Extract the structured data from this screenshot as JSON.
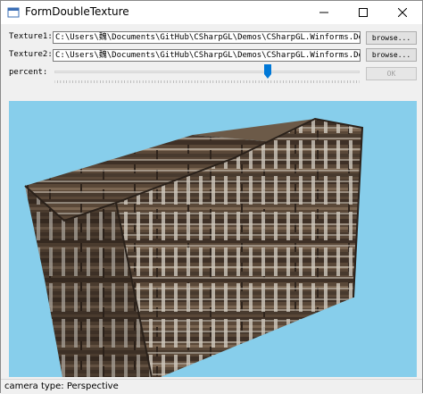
{
  "window": {
    "title": "FormDoubleTexture"
  },
  "texture1": {
    "label": "Texture1:",
    "value": "C:\\Users\\魏\\Documents\\GitHub\\CSharpGL\\Demos\\CSharpGL.Winforms.Demo\\bin\\Debug\\",
    "browse_label": "browse..."
  },
  "texture2": {
    "label": "Texture2:",
    "value": "C:\\Users\\魏\\Documents\\GitHub\\CSharpGL\\Demos\\CSharpGL.Winforms.Demo\\bin\\Debug\\",
    "browse_label": "browse..."
  },
  "percent": {
    "label": "percent:",
    "value_fraction": 0.7,
    "ok_label": "OK"
  },
  "status": {
    "text": "camera type: Perspective"
  },
  "colors": {
    "viewport_bg": "#87ceeb",
    "slider_thumb": "#0078d7",
    "wood_dark": "#4a3b2e",
    "wood_light": "#7d6a56"
  },
  "icons": [
    "app-icon",
    "minimize-icon",
    "maximize-icon",
    "close-icon"
  ]
}
